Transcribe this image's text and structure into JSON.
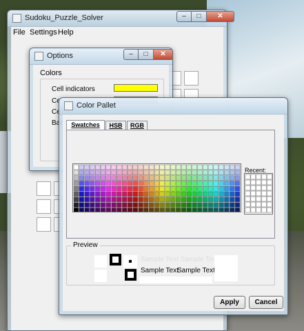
{
  "main_window": {
    "title": "Sudoku_Puzzle_Solver",
    "controls": {
      "minimize": "–",
      "maximize": "□",
      "close": "✕"
    },
    "menu": [
      {
        "label": "File"
      },
      {
        "label": "Settings"
      },
      {
        "label": "Help"
      }
    ]
  },
  "options_window": {
    "title": "Options",
    "controls": {
      "minimize": "–",
      "maximize": "□",
      "close": "✕"
    },
    "colors_group": {
      "title": "Colors",
      "rows": [
        {
          "label": "Cell indicators",
          "color": "#ffff00"
        },
        {
          "label": "Cell",
          "color": "#000000"
        },
        {
          "label": "Cell",
          "color": "#ffffff"
        },
        {
          "label": "Bac",
          "color": "#ffffff"
        }
      ]
    }
  },
  "color_pallet": {
    "title": "Color Pallet",
    "tabs": [
      {
        "label": "Swatches",
        "active": true
      },
      {
        "label": "HSB",
        "active": false
      },
      {
        "label": "RGB",
        "active": false
      }
    ],
    "recent_label": "Recent:",
    "preview": {
      "title": "Preview",
      "sample_text_faded": "Sample Text Sample Text",
      "sample_text_1": "Sample Text",
      "sample_text_2": "Sample Text"
    },
    "buttons": {
      "apply": "Apply",
      "cancel": "Cancel"
    },
    "swatch_grid": {
      "columns": 31,
      "rows": 9
    },
    "recent_grid": {
      "columns": 5,
      "rows": 7
    }
  },
  "colors": {
    "window_bg": "#f0f0f0",
    "frame": "#c8dae8",
    "yellow_indicator": "#ffff00"
  }
}
